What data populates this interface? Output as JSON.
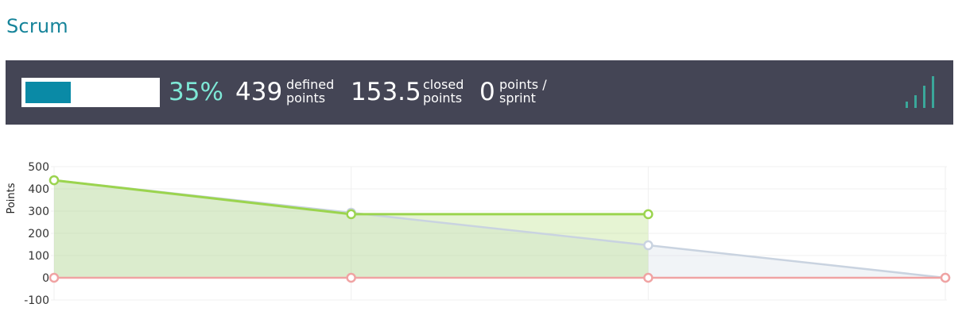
{
  "page": {
    "title": "Scrum"
  },
  "summary": {
    "progress": 0.35,
    "percent": "35%",
    "defined_points": "439",
    "defined_label_1": "defined",
    "defined_label_2": "points",
    "closed_points": "153.5",
    "closed_label_1": "closed",
    "closed_label_2": "points",
    "points_per_sprint": "0",
    "sprint_label_1": "points /",
    "sprint_label_2": "sprint",
    "icon": "signal-bars-icon"
  },
  "colors": {
    "title": "#16849a",
    "band": "#444555",
    "progress": "#0a8aa6",
    "percent": "#7ee8d6",
    "signal": "#3aa79a",
    "actual": "#9bd44e",
    "ideal": "#c9d3e0",
    "zero": "#f0a3a3"
  },
  "chart_data": {
    "type": "area",
    "ylabel": "Points",
    "xlabel": "",
    "ylim": [
      -100,
      500
    ],
    "yticks": [
      "500",
      "400",
      "300",
      "200",
      "100",
      "0",
      "-100"
    ],
    "grid": true,
    "x": [
      0,
      1,
      2,
      3
    ],
    "series": [
      {
        "values": [
          439,
          286,
          286,
          null
        ],
        "color": "#9bd44e"
      },
      {
        "values": [
          439,
          292.7,
          146.3,
          0
        ],
        "color": "#c9d3e0"
      },
      {
        "values": [
          0,
          0,
          0,
          0
        ],
        "color": "#f0a3a3"
      }
    ]
  }
}
